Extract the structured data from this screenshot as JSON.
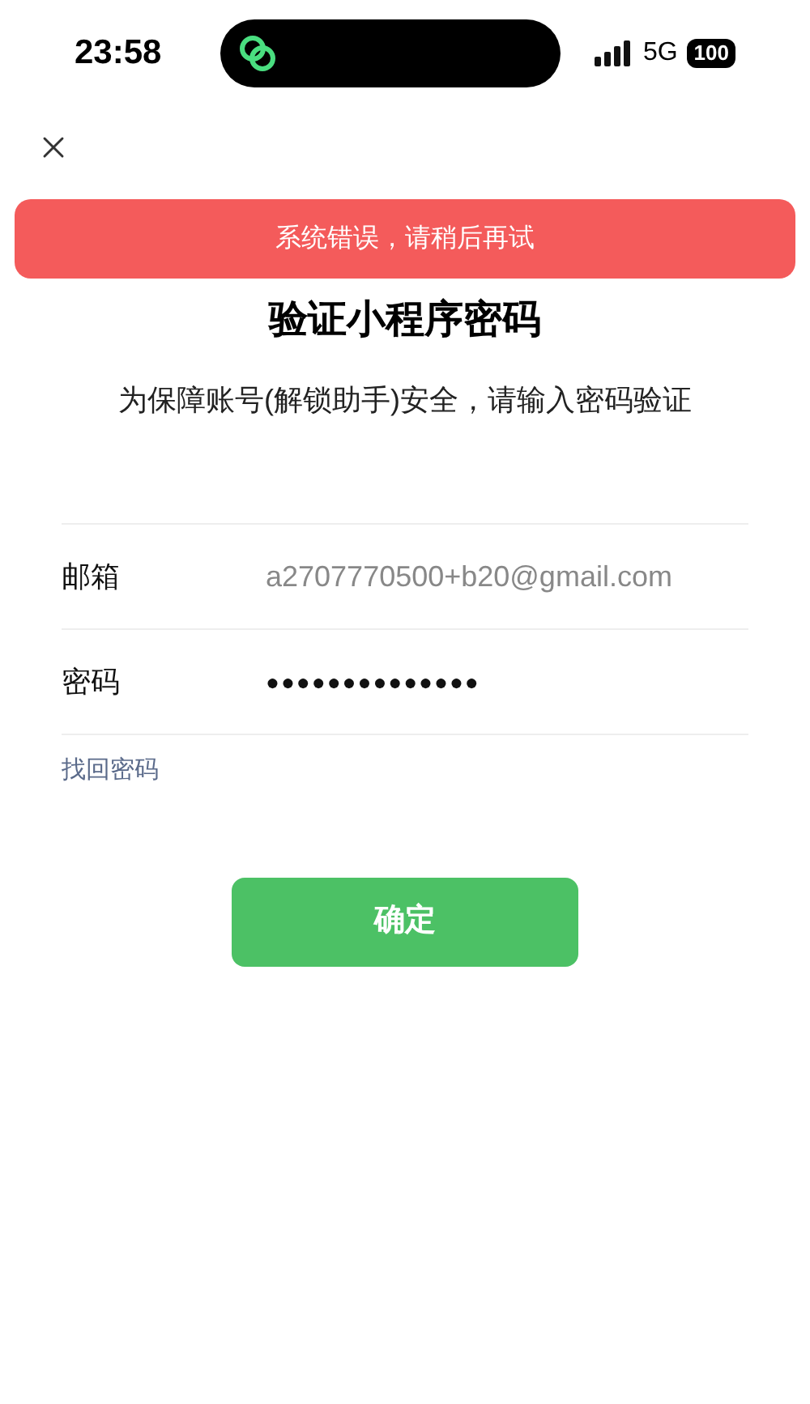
{
  "status_bar": {
    "time": "23:58",
    "network": "5G",
    "battery": "100"
  },
  "toast": {
    "message": "系统错误，请稍后再试"
  },
  "title": "验证小程序密码",
  "subtitle": "为保障账号(解锁助手)安全，请输入密码验证",
  "fields": [
    {
      "label": "邮箱",
      "value": "a2707770500+b20@gmail.com",
      "kind": "text"
    },
    {
      "label": "密码",
      "value": "●●●●●●●●●●●●●●",
      "kind": "password"
    }
  ],
  "forgot_link": "找回密码",
  "confirm_button": "确定"
}
